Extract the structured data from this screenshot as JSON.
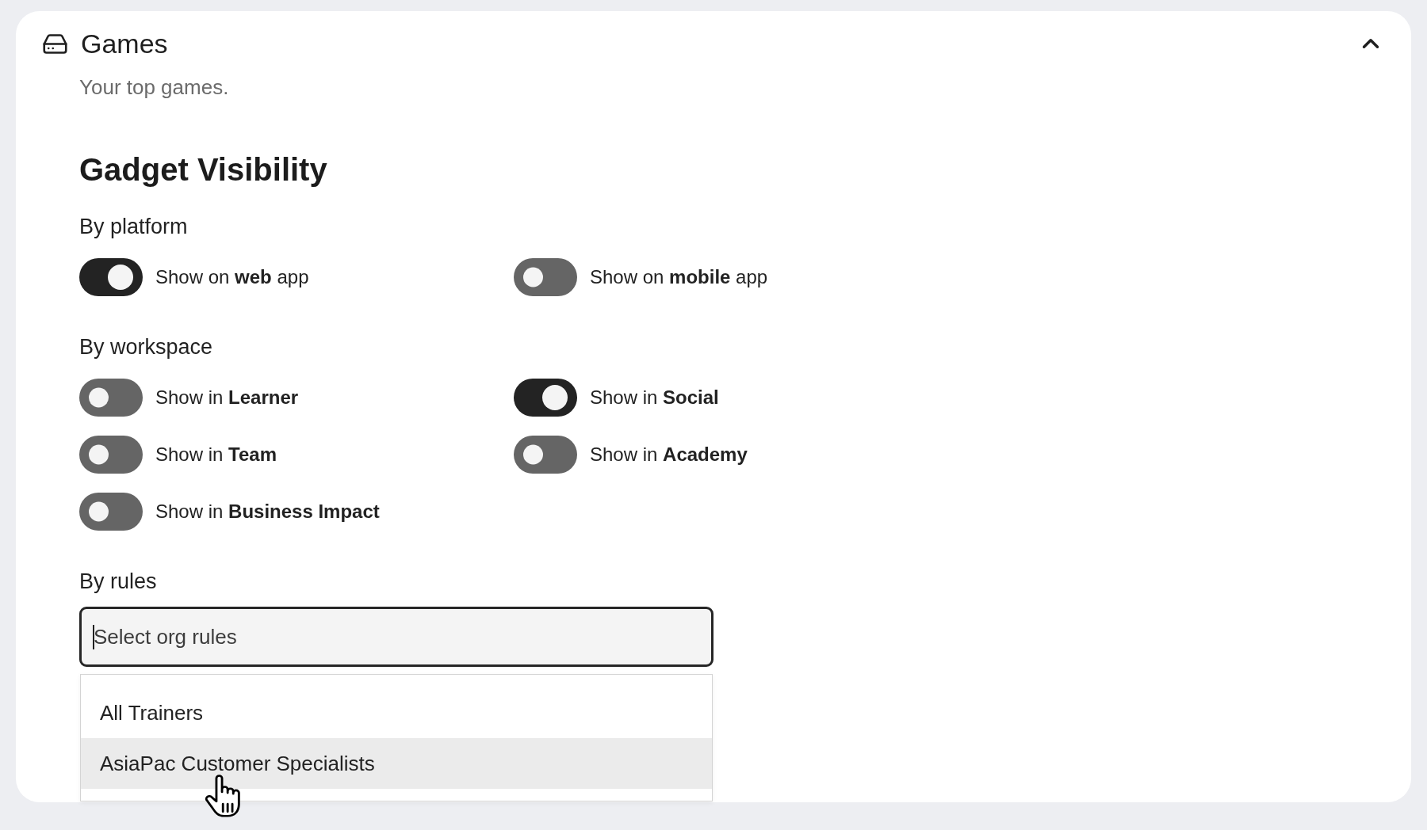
{
  "section": {
    "title": "Games",
    "subtitle": "Your top games.",
    "expanded": true
  },
  "visibility": {
    "heading": "Gadget Visibility",
    "groups": [
      {
        "label": "By platform",
        "toggles": [
          {
            "label": "Show on **web** app",
            "on": true
          },
          {
            "label": "Show on **mobile** app",
            "on": false
          }
        ]
      },
      {
        "label": "By workspace",
        "toggles": [
          {
            "label": "Show in **Learner**",
            "on": false
          },
          {
            "label": "Show in **Social**",
            "on": true
          },
          {
            "label": "Show in **Team**",
            "on": false
          },
          {
            "label": "Show in **Academy**",
            "on": false
          },
          {
            "label": "Show in **Business Impact**",
            "on": false
          }
        ]
      }
    ],
    "rules": {
      "label": "By rules",
      "field": {
        "placeholder": "Select org rules",
        "focused": true
      },
      "options": [
        {
          "label": "All Trainers",
          "hovered": false
        },
        {
          "label": "AsiaPac Customer Specialists",
          "hovered": true
        }
      ]
    }
  }
}
